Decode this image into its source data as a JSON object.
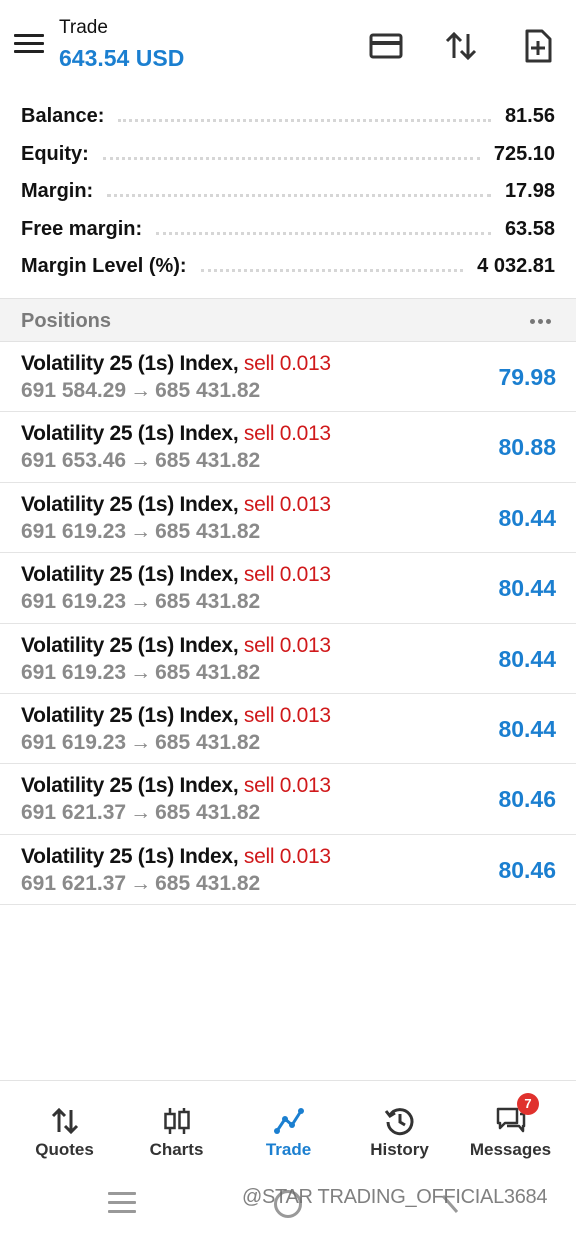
{
  "header": {
    "title": "Trade",
    "balance": "643.54 USD",
    "icons": [
      "menu-icon",
      "card-icon",
      "sort-icon",
      "new-order-icon"
    ]
  },
  "summary": [
    {
      "label": "Balance:",
      "value": "81.56"
    },
    {
      "label": "Equity:",
      "value": "725.10"
    },
    {
      "label": "Margin:",
      "value": "17.98"
    },
    {
      "label": "Free margin:",
      "value": "63.58"
    },
    {
      "label": "Margin Level (%):",
      "value": "4 032.81"
    }
  ],
  "positions": {
    "title": "Positions",
    "items": [
      {
        "symbol": "Volatility 25 (1s) Index,",
        "side": "sell 0.013",
        "open": "691 584.29",
        "arrow": "→",
        "current": "685 431.82",
        "profit": "79.98"
      },
      {
        "symbol": "Volatility 25 (1s) Index,",
        "side": "sell 0.013",
        "open": "691 653.46",
        "arrow": "→",
        "current": "685 431.82",
        "profit": "80.88"
      },
      {
        "symbol": "Volatility 25 (1s) Index,",
        "side": "sell 0.013",
        "open": "691 619.23",
        "arrow": "→",
        "current": "685 431.82",
        "profit": "80.44"
      },
      {
        "symbol": "Volatility 25 (1s) Index,",
        "side": "sell 0.013",
        "open": "691 619.23",
        "arrow": "→",
        "current": "685 431.82",
        "profit": "80.44"
      },
      {
        "symbol": "Volatility 25 (1s) Index,",
        "side": "sell 0.013",
        "open": "691 619.23",
        "arrow": "→",
        "current": "685 431.82",
        "profit": "80.44"
      },
      {
        "symbol": "Volatility 25 (1s) Index,",
        "side": "sell 0.013",
        "open": "691 619.23",
        "arrow": "→",
        "current": "685 431.82",
        "profit": "80.44"
      },
      {
        "symbol": "Volatility 25 (1s) Index,",
        "side": "sell 0.013",
        "open": "691 621.37",
        "arrow": "→",
        "current": "685 431.82",
        "profit": "80.46"
      },
      {
        "symbol": "Volatility 25 (1s) Index,",
        "side": "sell 0.013",
        "open": "691 621.37",
        "arrow": "→",
        "current": "685 431.82",
        "profit": "80.46"
      }
    ]
  },
  "tabs": [
    {
      "label": "Quotes",
      "icon": "quotes-icon"
    },
    {
      "label": "Charts",
      "icon": "charts-icon"
    },
    {
      "label": "Trade",
      "icon": "trade-icon",
      "active": true
    },
    {
      "label": "History",
      "icon": "history-icon"
    },
    {
      "label": "Messages",
      "icon": "messages-icon",
      "badge": "7"
    }
  ],
  "watermark": "@STAR TRADING_OFFICIAL3684",
  "colors": {
    "accent": "#1b7fd0",
    "sell": "#d0191b",
    "badge": "#e0312d"
  }
}
